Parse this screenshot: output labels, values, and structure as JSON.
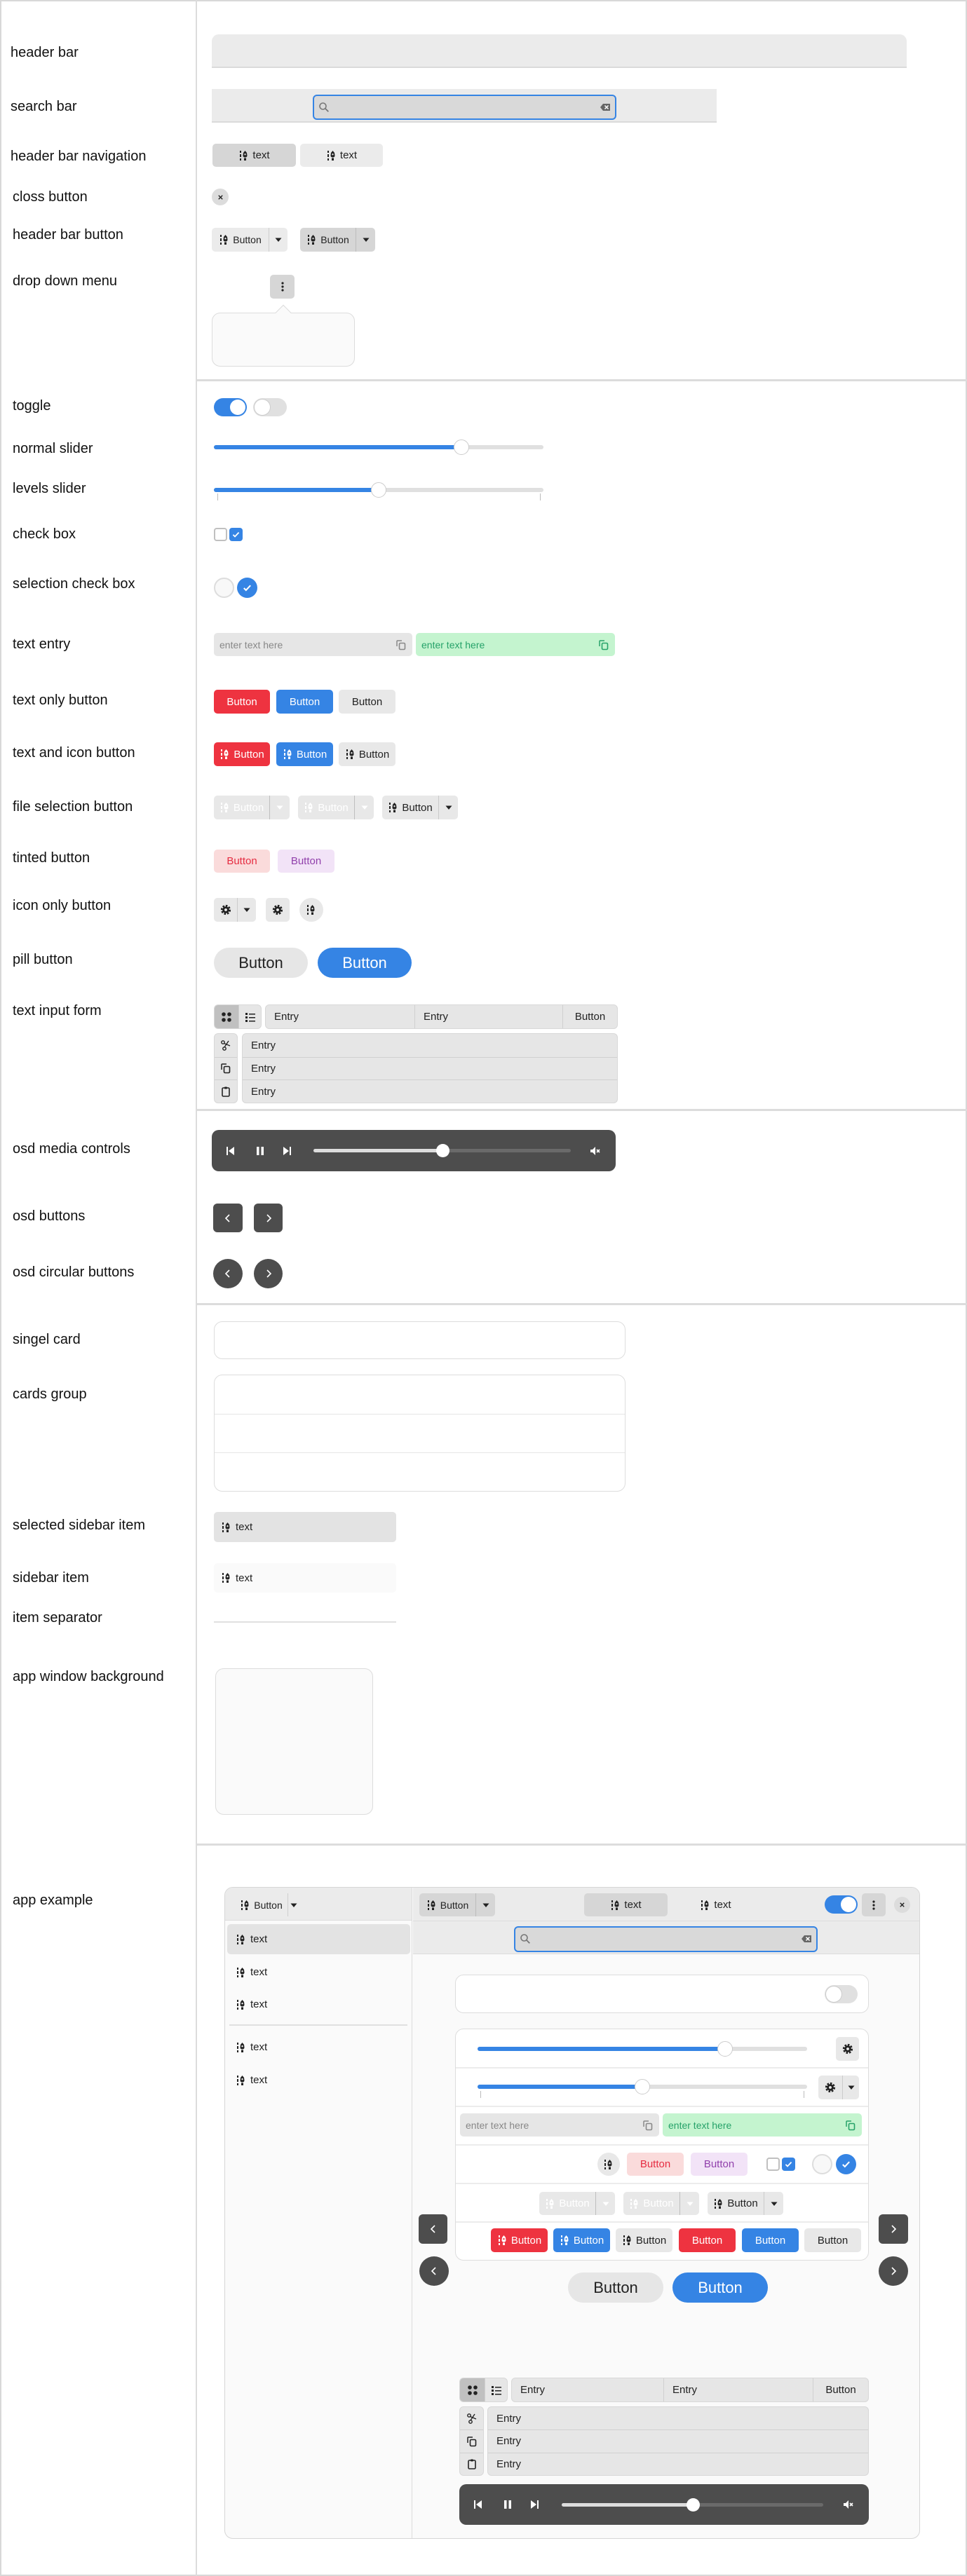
{
  "labels": [
    "header bar",
    "search bar",
    "header bar navigation",
    "closs button",
    "header bar button",
    "drop down menu",
    "toggle",
    "normal slider",
    "levels slider",
    "check box",
    "selection check box",
    "text entry",
    "text only button",
    "text and icon button",
    "file selection button",
    "tinted button",
    "icon only button",
    "pill button",
    "text input form",
    "osd media controls",
    "osd buttons",
    "osd circular buttons",
    "singel card",
    "cards group",
    "selected sidebar item",
    "sidebar item",
    "item separator",
    "app window background",
    "app example"
  ],
  "colors": {
    "accent": "#3584e4",
    "destructive": "#ee3340",
    "success_bg": "#c4f4cf",
    "success_text": "#26a269",
    "tint_red_bg": "#fadbdb",
    "tint_red_text": "#e62d42",
    "tint_purple_bg": "#f2e3f7",
    "tint_purple_text": "#9141ac",
    "osd_bg": "#4d4d4d",
    "headerbar_bg": "#ebebeb"
  },
  "nav_tabs": [
    {
      "label": "text",
      "selected": true
    },
    {
      "label": "text",
      "selected": false
    }
  ],
  "header_bar_buttons": [
    "Button",
    "Button"
  ],
  "toggles": [
    true,
    false
  ],
  "normal_slider": {
    "value": 0.75
  },
  "levels_slider": {
    "value": 0.5
  },
  "check_boxes": [
    false,
    true
  ],
  "selection_check_boxes": [
    false,
    true
  ],
  "text_entries": [
    {
      "placeholder": "enter text here",
      "state": "default"
    },
    {
      "placeholder": "enter text here",
      "state": "success"
    }
  ],
  "text_only_buttons": [
    "Button",
    "Button",
    "Button"
  ],
  "text_icon_buttons": [
    "Button",
    "Button",
    "Button"
  ],
  "file_selection_buttons": [
    "Button",
    "Button",
    "Button"
  ],
  "tinted_buttons": [
    "Button",
    "Button"
  ],
  "pill_buttons": [
    "Button",
    "Button"
  ],
  "form": {
    "entries": [
      "Entry",
      "Entry"
    ],
    "button": "Button",
    "rows": [
      "Entry",
      "Entry",
      "Entry"
    ],
    "view_mode": "grid"
  },
  "media": {
    "progress": 0.5,
    "playing": true,
    "muted": true
  },
  "sidebar_item": {
    "label": "text"
  },
  "app": {
    "sidebar_button": "Button",
    "sidebar_items": [
      "text",
      "text",
      "text",
      "text",
      "text"
    ],
    "header_button": "Button",
    "tabs": [
      "text",
      "text"
    ],
    "header_toggle": true,
    "card_toggle": false,
    "slider1": 0.75,
    "slider2": 0.5,
    "entries": [
      "enter text here",
      "enter text here"
    ],
    "tinted": [
      "Button",
      "Button"
    ],
    "file_buttons": [
      "Button",
      "Button",
      "Button"
    ],
    "buttons": [
      "Button",
      "Button",
      "Button",
      "Button",
      "Button",
      "Button"
    ],
    "pills": [
      "Button",
      "Button"
    ],
    "form": {
      "entries": [
        "Entry",
        "Entry"
      ],
      "button": "Button",
      "rows": [
        "Entry",
        "Entry",
        "Entry"
      ]
    }
  }
}
